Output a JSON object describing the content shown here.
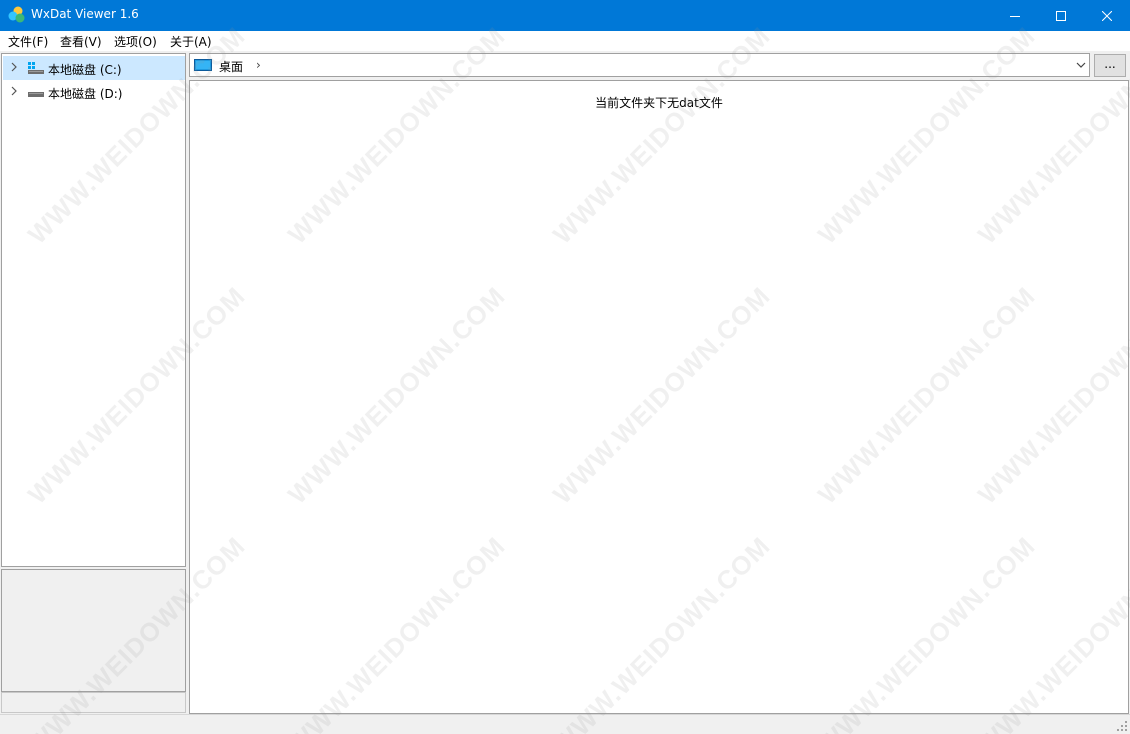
{
  "window": {
    "title": "WxDat Viewer 1.6"
  },
  "menu": [
    "文件(F)",
    "查看(V)",
    "选项(O)",
    "关于(A)"
  ],
  "tree": [
    {
      "label": "本地磁盘 (C:)",
      "selected": true,
      "icon": "system-drive-icon"
    },
    {
      "label": "本地磁盘 (D:)",
      "selected": false,
      "icon": "drive-icon"
    }
  ],
  "address": {
    "location": "桌面",
    "separator": "›",
    "icon": "desktop-icon"
  },
  "browse_button": "...",
  "content": {
    "empty_message": "当前文件夹下无dat文件"
  },
  "watermark": "WWW.WEIDOWN.COM",
  "colors": {
    "titlebar": "#0078d7",
    "selection": "#cce8ff"
  }
}
